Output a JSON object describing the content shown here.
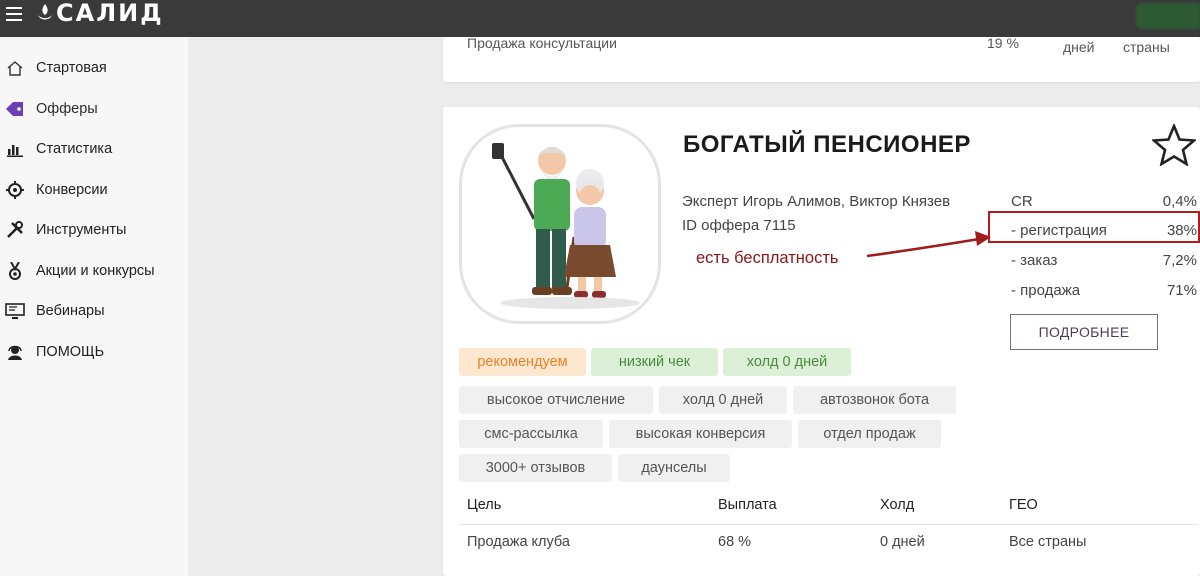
{
  "brand": {
    "logo_text": "САЛИД",
    "accent": "#3a3a3a",
    "active_icon_color": "#6a3fb5"
  },
  "sidebar": {
    "items": [
      {
        "label": "Стартовая",
        "icon": "home-icon"
      },
      {
        "label": "Офферы",
        "icon": "tag-icon"
      },
      {
        "label": "Статистика",
        "icon": "bar-chart-icon"
      },
      {
        "label": "Конверсии",
        "icon": "target-icon"
      },
      {
        "label": "Инструменты",
        "icon": "tools-icon"
      },
      {
        "label": "Акции и конкурсы",
        "icon": "medal-icon"
      },
      {
        "label": "Вебинары",
        "icon": "monitor-icon"
      },
      {
        "label": "ПОМОЩЬ",
        "icon": "support-icon"
      }
    ]
  },
  "prev_card": {
    "goal": "Продажа консультации",
    "payout": "19 %",
    "hold": "дней",
    "geo": "страны"
  },
  "offer": {
    "title": "БОГАТЫЙ ПЕНСИОНЕР",
    "experts": "Эксперт Игорь Алимов, Виктор Князев",
    "offer_id": "ID оффера 7115",
    "annotation": "есть бесплатность",
    "stats": [
      {
        "label": "CR",
        "value": "0,4%"
      },
      {
        "label": "- регистрация",
        "value": "38%"
      },
      {
        "label": "- заказ",
        "value": "7,2%"
      },
      {
        "label": "- продажа",
        "value": "71%"
      }
    ],
    "more_button": "ПОДРОБНЕЕ",
    "tags": [
      {
        "label": "рекомендуем",
        "style": "orange"
      },
      {
        "label": "низкий чек",
        "style": "green"
      },
      {
        "label": "холд 0 дней",
        "style": "green"
      },
      {
        "label": "высокое отчисление",
        "style": "gray"
      },
      {
        "label": "холд 0 дней",
        "style": "gray"
      },
      {
        "label": "автозвонок бота",
        "style": "gray"
      },
      {
        "label": "смс-рассылка",
        "style": "gray"
      },
      {
        "label": "высокая конверсия",
        "style": "gray"
      },
      {
        "label": "отдел продаж",
        "style": "gray"
      },
      {
        "label": "3000+ отзывов",
        "style": "gray"
      },
      {
        "label": "даунселы",
        "style": "gray"
      }
    ],
    "table": {
      "headers": [
        "Цель",
        "Выплата",
        "Холд",
        "ГЕО"
      ],
      "row": [
        "Продажа клуба",
        "68 %",
        "0 дней",
        "Все страны"
      ]
    }
  }
}
